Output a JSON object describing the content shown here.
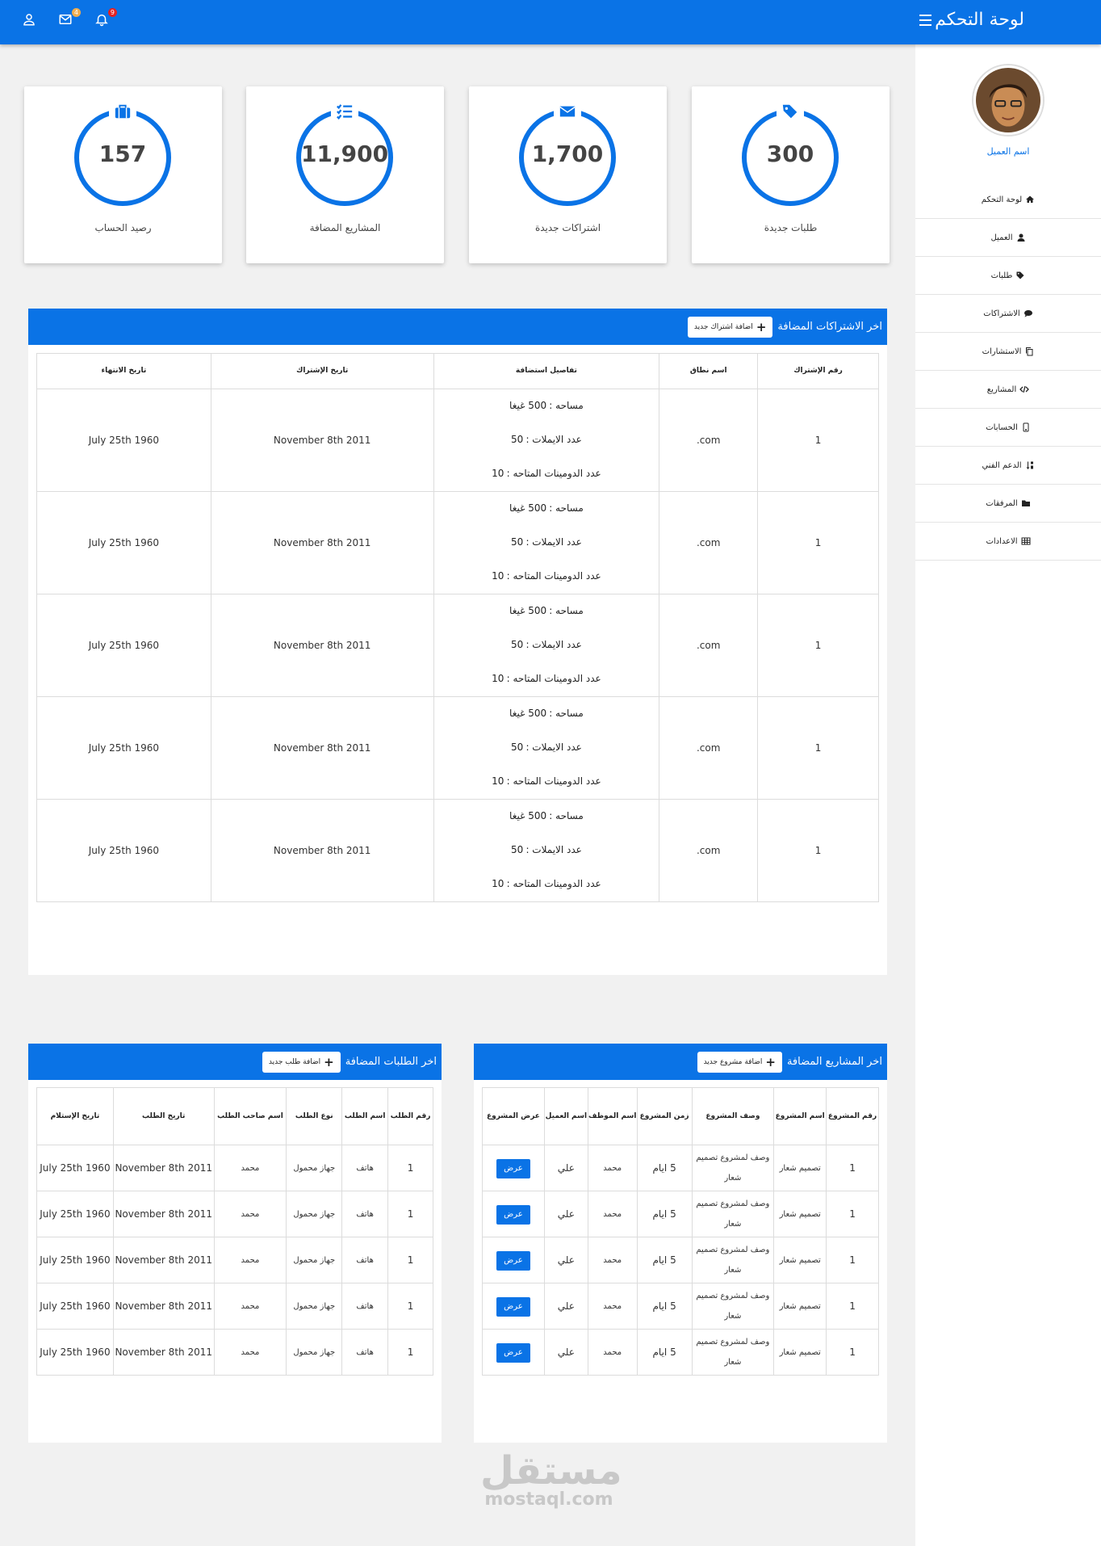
{
  "topbar": {
    "title": "لوحة التحكم",
    "messages_badge": "4",
    "notifications_badge": "9",
    "messages_badge_color": "#f0ad4e",
    "notifications_badge_color": "#e52222"
  },
  "sidebar": {
    "client_name": "اسم العميل",
    "items": [
      {
        "label": "لوحة التحكم",
        "icon": "home-icon"
      },
      {
        "label": "العميل",
        "icon": "user-icon"
      },
      {
        "label": "طلبات",
        "icon": "tag-icon"
      },
      {
        "label": "الاشتراكات",
        "icon": "comment-icon"
      },
      {
        "label": "الاستشارات",
        "icon": "copy-icon"
      },
      {
        "label": "المشاريع",
        "icon": "code-icon"
      },
      {
        "label": "الحسابات",
        "icon": "mobile-icon"
      },
      {
        "label": "الدعم الفني",
        "icon": "sort-icon"
      },
      {
        "label": "المرفقات",
        "icon": "folder-icon"
      },
      {
        "label": "الاعدادات",
        "icon": "table-icon"
      }
    ]
  },
  "stats": [
    {
      "value": "300",
      "label": "طلبات جديدة",
      "icon": "tags-icon"
    },
    {
      "value": "1,700",
      "label": "اشتراكات جديدة",
      "icon": "envelope-icon"
    },
    {
      "value": "11,900",
      "label": "المشاريع المضافة",
      "icon": "tasks-icon"
    },
    {
      "value": "157",
      "label": "رصيد الحساب",
      "icon": "briefcase-icon"
    }
  ],
  "subscriptions": {
    "title": "اخر الاشتراكات المضافة",
    "add_label": "اضافة اشتراك جديد",
    "headers": [
      "رقم الإشتراك",
      "اسم نطاق",
      "تفاصيل استضافة",
      "تاريخ الإشتراك",
      "تاريخ الانتهاء"
    ],
    "rows": [
      {
        "id": "1",
        "domain": "com.",
        "space_label": "مساحه :",
        "space_val": "500 غيغا",
        "emails_label": "عدد الايملات :",
        "emails_val": "50",
        "domains_label": "عدد الدومينات المتاحه :",
        "domains_val": "10",
        "start": "November 8th 2011",
        "end": "July 25th 1960"
      },
      {
        "id": "1",
        "domain": "com.",
        "space_label": "مساحه :",
        "space_val": "500 غيغا",
        "emails_label": "عدد الايملات :",
        "emails_val": "50",
        "domains_label": "عدد الدومينات المتاحه :",
        "domains_val": "10",
        "start": "November 8th 2011",
        "end": "July 25th 1960"
      },
      {
        "id": "1",
        "domain": "com.",
        "space_label": "مساحه :",
        "space_val": "500 غيغا",
        "emails_label": "عدد الايملات :",
        "emails_val": "50",
        "domains_label": "عدد الدومينات المتاحه :",
        "domains_val": "10",
        "start": "November 8th 2011",
        "end": "July 25th 1960"
      },
      {
        "id": "1",
        "domain": "com.",
        "space_label": "مساحه :",
        "space_val": "500 غيغا",
        "emails_label": "عدد الايملات :",
        "emails_val": "50",
        "domains_label": "عدد الدومينات المتاحه :",
        "domains_val": "10",
        "start": "November 8th 2011",
        "end": "July 25th 1960"
      },
      {
        "id": "1",
        "domain": "com.",
        "space_label": "مساحه :",
        "space_val": "500 غيغا",
        "emails_label": "عدد الايملات :",
        "emails_val": "50",
        "domains_label": "عدد الدومينات المتاحه :",
        "domains_val": "10",
        "start": "November 8th 2011",
        "end": "July 25th 1960"
      }
    ]
  },
  "projects": {
    "title": "اخر المشاريع المضافة",
    "add_label": "اضافة مشروع جديد",
    "headers": [
      "رقم المشروع",
      "اسم المشروع",
      "وصف المشروع",
      "زمن المشروع",
      "اسم الموظف",
      "اسم العميل",
      "عرض المشروع"
    ],
    "rows": [
      {
        "id": "1",
        "name": "تصميم شعار",
        "desc": "وصف لمشروع تصميم شعار",
        "time": "5 ايام",
        "employee": "محمد",
        "client": "علي",
        "view": "عرض"
      },
      {
        "id": "1",
        "name": "تصميم شعار",
        "desc": "وصف لمشروع تصميم شعار",
        "time": "5 ايام",
        "employee": "محمد",
        "client": "علي",
        "view": "عرض"
      },
      {
        "id": "1",
        "name": "تصميم شعار",
        "desc": "وصف لمشروع تصميم شعار",
        "time": "5 ايام",
        "employee": "محمد",
        "client": "علي",
        "view": "عرض"
      },
      {
        "id": "1",
        "name": "تصميم شعار",
        "desc": "وصف لمشروع تصميم شعار",
        "time": "5 ايام",
        "employee": "محمد",
        "client": "علي",
        "view": "عرض"
      },
      {
        "id": "1",
        "name": "تصميم شعار",
        "desc": "وصف لمشروع تصميم شعار",
        "time": "5 ايام",
        "employee": "محمد",
        "client": "علي",
        "view": "عرض"
      }
    ]
  },
  "orders": {
    "title": "اخر الطلبات المضافة",
    "add_label": "اضافة طلب جديد",
    "headers": [
      "رقم الطلب",
      "اسم الطلب",
      "نوع الطلب",
      "اسم صاحب الطلب",
      "تاريخ الطلب",
      "تاريخ الإستلام"
    ],
    "rows": [
      {
        "id": "1",
        "name": "هاتف",
        "type": "جهاز محمول",
        "owner": "محمد",
        "date": "November 8th 2011",
        "received": "July 25th 1960"
      },
      {
        "id": "1",
        "name": "هاتف",
        "type": "جهاز محمول",
        "owner": "محمد",
        "date": "November 8th 2011",
        "received": "July 25th 1960"
      },
      {
        "id": "1",
        "name": "هاتف",
        "type": "جهاز محمول",
        "owner": "محمد",
        "date": "November 8th 2011",
        "received": "July 25th 1960"
      },
      {
        "id": "1",
        "name": "هاتف",
        "type": "جهاز محمول",
        "owner": "محمد",
        "date": "November 8th 2011",
        "received": "July 25th 1960"
      },
      {
        "id": "1",
        "name": "هاتف",
        "type": "جهاز محمول",
        "owner": "محمد",
        "date": "November 8th 2011",
        "received": "July 25th 1960"
      }
    ]
  },
  "watermark": {
    "arabic": "مستقل",
    "latin": "mostaql.com"
  }
}
